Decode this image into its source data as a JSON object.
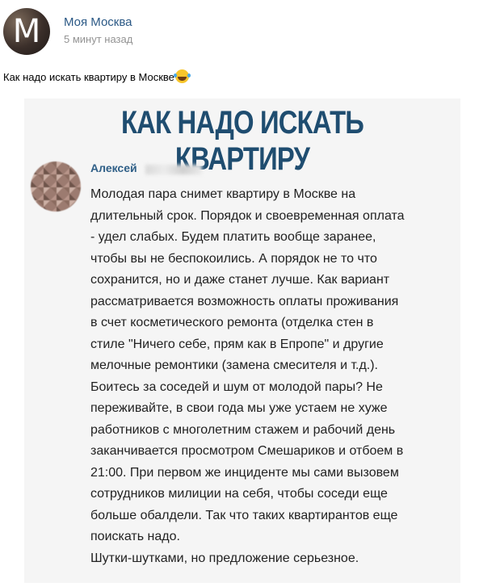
{
  "post": {
    "author": "Моя Москва",
    "avatar_letter": "M",
    "time": "5 минут назад",
    "text": "Как надо искать квартиру в Москве",
    "emoji": "laughing-tears-icon"
  },
  "image": {
    "title": "КАК НАДО ИСКАТЬ КВАРТИРУ",
    "comment_author": "Алексей",
    "comment_text": "Молодая пара снимет квартиру в Москве на\nдлительный срок. Порядок и своевременная оплата\n- удел слабых. Будем платить вообще заранее,\nчтобы вы не беспокоились. А порядок не то что\nсохранится, но и даже станет лучше. Как вариант\nрассматривается возможность оплаты проживания\nв счет косметического ремонта (отделка стен в\nстиле \"Ничего себе, прям как в Епропе\" и другие\nмелочные ремонтики (замена смесителя и т.д.).\nБоитесь за соседей и шум от молодой пары? Не\nпереживайте, в свои года мы уже устаем не хуже\nработников с многолетним стажем и рабочий день\nзаканчивается просмотром Смешариков и отбоем в\n21:00. При первом же инциденте мы сами вызовем\nсотрудников милиции на себя, чтобы соседи еще\nбольше обалдели. Так что таких квартирантов еще\nпоискать надо.\nШутки-шутками, но предложение серьезное."
  },
  "colors": {
    "link": "#2a5885",
    "time": "#939393",
    "title": "#1f4d70"
  }
}
